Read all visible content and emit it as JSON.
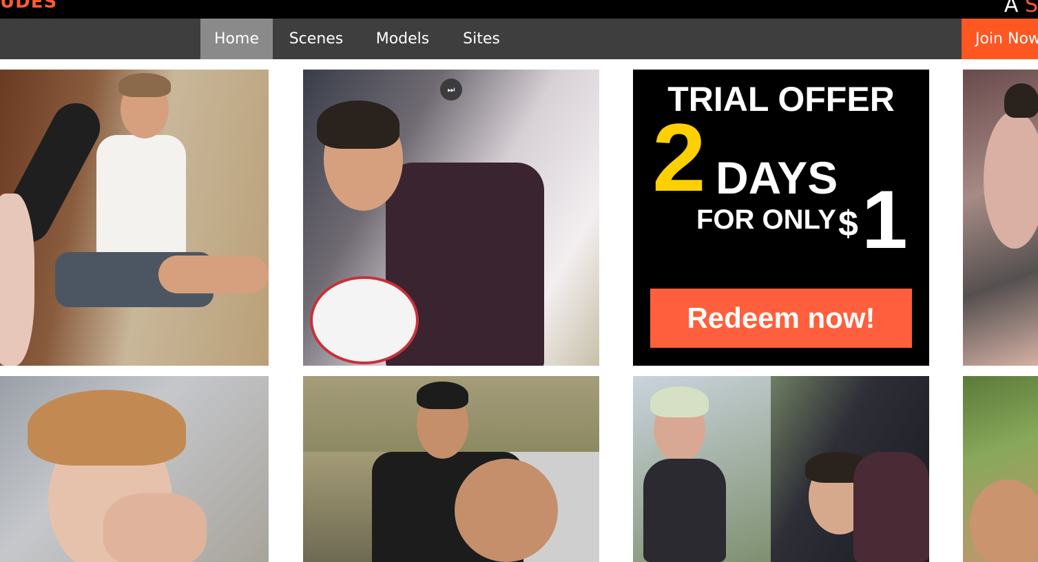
{
  "topbar": {
    "logo_fragment": "UDES",
    "right_fragment_main": "A",
    "right_fragment_accent": "S"
  },
  "nav": {
    "items": [
      {
        "label": "Home",
        "active": true
      },
      {
        "label": "Scenes"
      },
      {
        "label": "Models"
      },
      {
        "label": "Sites"
      }
    ],
    "join_label": "Join Now"
  },
  "promo": {
    "title": "TRIAL OFFER",
    "number": "2",
    "unit": "DAYS",
    "for_only": "FOR ONLY",
    "currency": "$",
    "price": "1",
    "cta": "Redeem now!"
  },
  "player": {
    "skip_icon": "skip-forward-icon",
    "skip_glyph": "⏭"
  },
  "colors": {
    "brand_orange": "#ff5722",
    "nav_bg": "#3e3e3e",
    "nav_active_bg": "#8a8a8a",
    "promo_yellow": "#ffd000"
  }
}
